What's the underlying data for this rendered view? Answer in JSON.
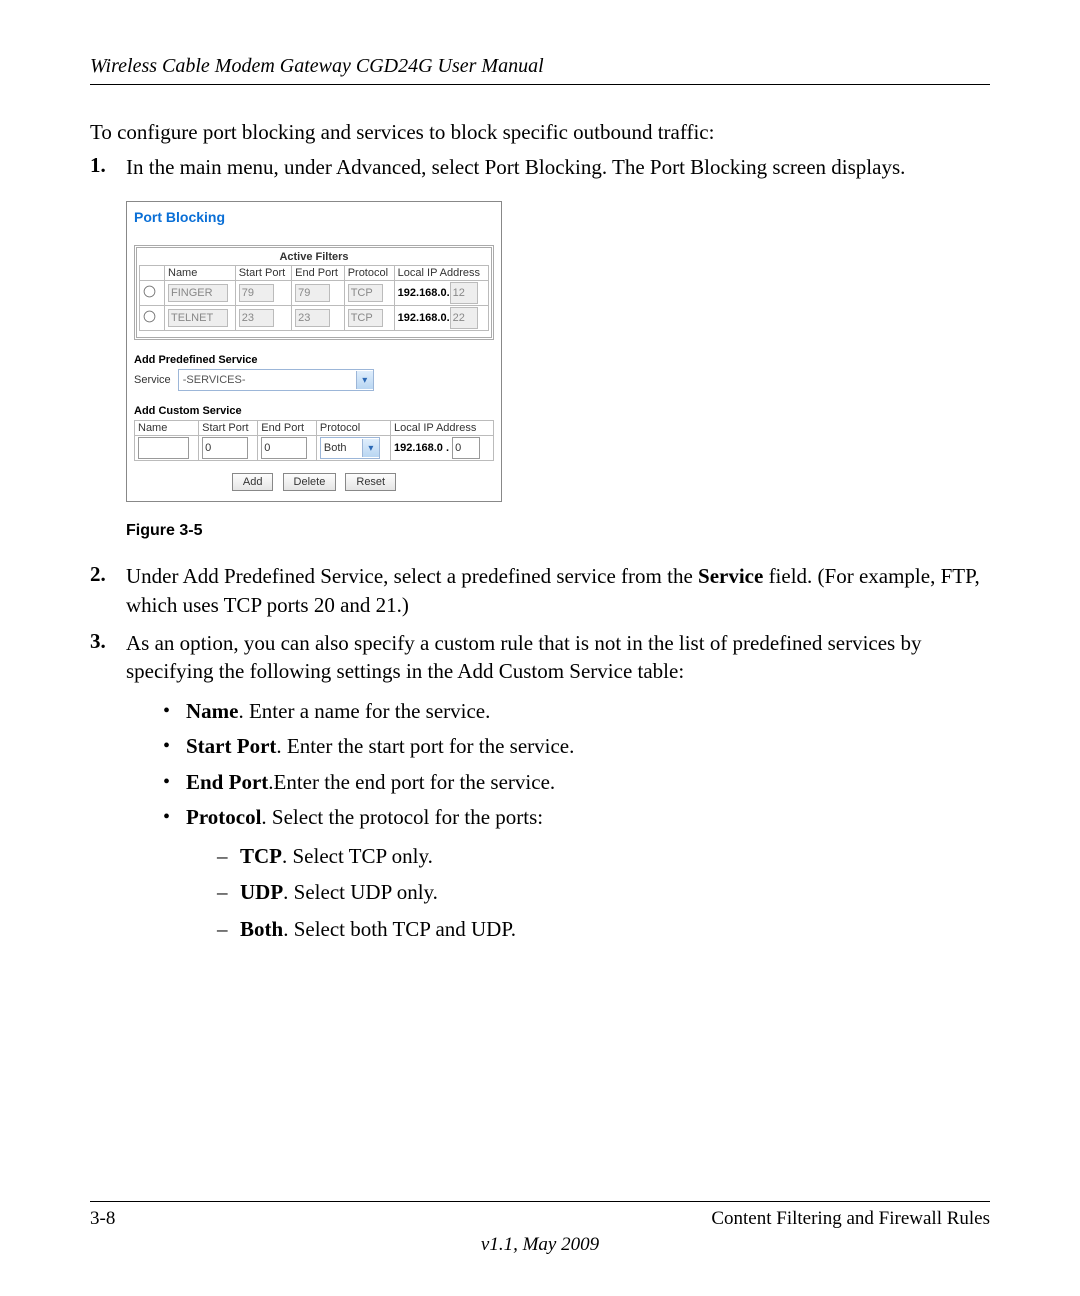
{
  "header": "Wireless Cable Modem Gateway CGD24G User Manual",
  "intro": "To configure port blocking and services to block specific outbound traffic:",
  "step1_num": "1.",
  "step1_txt": "In the main menu, under Advanced, select Port Blocking. The Port Blocking screen displays.",
  "pb": {
    "title": "Port Blocking",
    "active_filters_title": "Active Filters",
    "cols": {
      "name": "Name",
      "start": "Start Port",
      "end": "End Port",
      "proto": "Protocol",
      "ip": "Local IP Address"
    },
    "rows": [
      {
        "name": "FINGER",
        "start": "79",
        "end": "79",
        "proto": "TCP",
        "ip_prefix": "192.168.0.",
        "ip_oct": "12"
      },
      {
        "name": "TELNET",
        "start": "23",
        "end": "23",
        "proto": "TCP",
        "ip_prefix": "192.168.0.",
        "ip_oct": "22"
      }
    ],
    "predef_label": "Add Predefined Service",
    "service_label": "Service",
    "service_value": "-SERVICES-",
    "custom_label": "Add Custom Service",
    "custom_cols": {
      "name": "Name",
      "start": "Start Port",
      "end": "End Port",
      "proto": "Protocol",
      "ip": "Local IP Address"
    },
    "custom_row": {
      "name": "",
      "start": "0",
      "end": "0",
      "proto": "Both",
      "ip_prefix": "192.168.0 .",
      "ip_oct": "0"
    },
    "btn_add": "Add",
    "btn_delete": "Delete",
    "btn_reset": "Reset"
  },
  "fig_caption": "Figure 3-5",
  "step2_num": "2.",
  "step2_pre": "Under Add Predefined Service, select a predefined service from the ",
  "step2_bold": "Service",
  "step2_post": " field. (For example, FTP, which uses TCP ports 20 and 21.)",
  "step3_num": "3.",
  "step3_txt": "As an option, you can also specify a custom rule that is not in the list of predefined services by specifying the following settings in the Add Custom Service table:",
  "b_name_b": "Name",
  "b_name_t": ". Enter a name for the service.",
  "b_start_b": "Start Port",
  "b_start_t": ". Enter the start port for the service.",
  "b_end_b": "End Port",
  "b_end_t": ".Enter the end port for the service.",
  "b_proto_b": "Protocol",
  "b_proto_t": ". Select the protocol for the ports:",
  "d_tcp_b": "TCP",
  "d_tcp_t": ". Select TCP only.",
  "d_udp_b": "UDP",
  "d_udp_t": ". Select UDP only.",
  "d_both_b": "Both",
  "d_both_t": ". Select both TCP and UDP.",
  "footer_left": "3-8",
  "footer_right": "Content Filtering and Firewall Rules",
  "footer_ver": "v1.1, May 2009"
}
